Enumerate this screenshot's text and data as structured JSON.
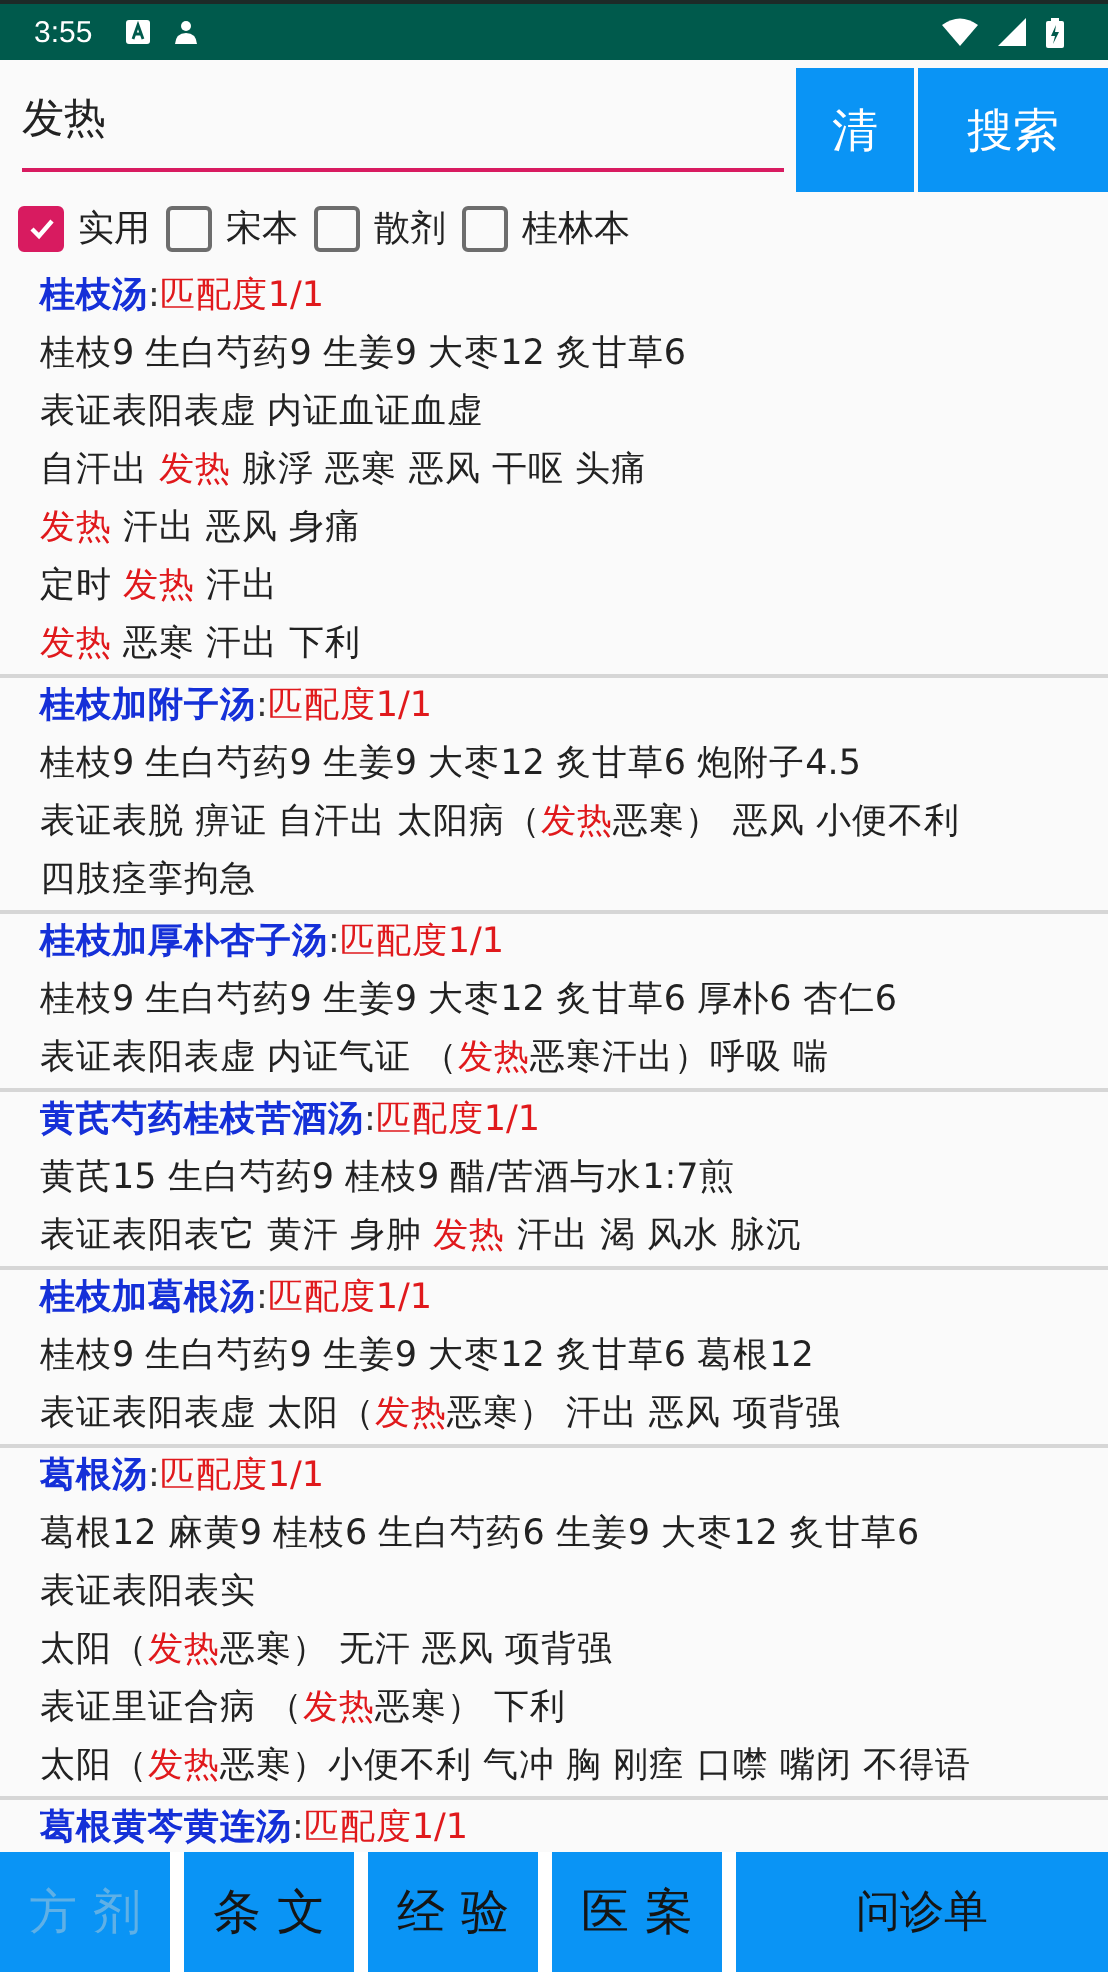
{
  "status_bar": {
    "time": "3:55"
  },
  "search": {
    "value": "发热",
    "buttons": [
      "清",
      "搜索"
    ]
  },
  "filters": [
    {
      "label": "实用",
      "checked": true
    },
    {
      "label": "宋本",
      "checked": false
    },
    {
      "label": "散剂",
      "checked": false
    },
    {
      "label": "桂林本",
      "checked": false
    }
  ],
  "results": [
    {
      "name": "桂枝汤",
      "separator": ":",
      "match": "匹配度1/1",
      "lines": [
        [
          {
            "text": "桂枝9 生白芍药9 生姜9 大枣12 炙甘草6",
            "hit": false
          }
        ],
        [
          {
            "text": "表证表阳表虚 内证血证血虚",
            "hit": false
          }
        ],
        [
          {
            "text": "自汗出 ",
            "hit": false
          },
          {
            "text": "发热",
            "hit": true
          },
          {
            "text": " 脉浮 恶寒 恶风 干呕 头痛",
            "hit": false
          }
        ],
        [
          {
            "text": "发热",
            "hit": true
          },
          {
            "text": " 汗出 恶风 身痛",
            "hit": false
          }
        ],
        [
          {
            "text": "定时 ",
            "hit": false
          },
          {
            "text": "发热",
            "hit": true
          },
          {
            "text": " 汗出",
            "hit": false
          }
        ],
        [
          {
            "text": "发热",
            "hit": true
          },
          {
            "text": " 恶寒 汗出 下利",
            "hit": false
          }
        ]
      ]
    },
    {
      "name": "桂枝加附子汤",
      "separator": ":",
      "match": "匹配度1/1",
      "lines": [
        [
          {
            "text": "桂枝9 生白芍药9 生姜9 大枣12 炙甘草6 炮附子4.5",
            "hit": false
          }
        ],
        [
          {
            "text": "表证表脱 痹证 自汗出 太阳病（",
            "hit": false
          },
          {
            "text": "发热",
            "hit": true
          },
          {
            "text": "恶寒） 恶风 小便不利",
            "hit": false
          }
        ],
        [
          {
            "text": "四肢痉挛拘急",
            "hit": false
          }
        ]
      ]
    },
    {
      "name": "桂枝加厚朴杏子汤",
      "separator": ":",
      "match": "匹配度1/1",
      "lines": [
        [
          {
            "text": "桂枝9 生白芍药9 生姜9 大枣12 炙甘草6 厚朴6 杏仁6",
            "hit": false
          }
        ],
        [
          {
            "text": "表证表阳表虚 内证气证 （",
            "hit": false
          },
          {
            "text": "发热",
            "hit": true
          },
          {
            "text": "恶寒汗出）呼吸 喘",
            "hit": false
          }
        ]
      ]
    },
    {
      "name": "黄芪芍药桂枝苦酒汤",
      "separator": ":",
      "match": "匹配度1/1",
      "lines": [
        [
          {
            "text": "黄芪15 生白芍药9 桂枝9 醋/苦酒与水1:7煎",
            "hit": false
          }
        ],
        [
          {
            "text": "表证表阳表它 黄汗 身肿 ",
            "hit": false
          },
          {
            "text": "发热",
            "hit": true
          },
          {
            "text": " 汗出 渴 风水 脉沉",
            "hit": false
          }
        ]
      ]
    },
    {
      "name": "桂枝加葛根汤",
      "separator": ":",
      "match": "匹配度1/1",
      "lines": [
        [
          {
            "text": "桂枝9 生白芍药9 生姜9 大枣12 炙甘草6 葛根12",
            "hit": false
          }
        ],
        [
          {
            "text": "表证表阳表虚 太阳（",
            "hit": false
          },
          {
            "text": "发热",
            "hit": true
          },
          {
            "text": "恶寒） 汗出 恶风 项背强",
            "hit": false
          }
        ]
      ]
    },
    {
      "name": "葛根汤",
      "separator": ":",
      "match": "匹配度1/1",
      "lines": [
        [
          {
            "text": "葛根12 麻黄9 桂枝6 生白芍药6 生姜9 大枣12 炙甘草6",
            "hit": false
          }
        ],
        [
          {
            "text": "表证表阳表实",
            "hit": false
          }
        ],
        [
          {
            "text": "太阳（",
            "hit": false
          },
          {
            "text": "发热",
            "hit": true
          },
          {
            "text": "恶寒） 无汗 恶风 项背强",
            "hit": false
          }
        ],
        [
          {
            "text": "表证里证合病 （",
            "hit": false
          },
          {
            "text": "发热",
            "hit": true
          },
          {
            "text": "恶寒） 下利",
            "hit": false
          }
        ],
        [
          {
            "text": "太阳（",
            "hit": false
          },
          {
            "text": "发热",
            "hit": true
          },
          {
            "text": "恶寒）小便不利 气冲 胸 刚痓 口噤 嘴闭 不得语",
            "hit": false
          }
        ]
      ]
    },
    {
      "name": "葛根黄芩黄连汤",
      "separator": ":",
      "match": "匹配度1/1"
    }
  ],
  "tabs": [
    {
      "label": "方剂",
      "selected": true
    },
    {
      "label": "条文",
      "selected": false
    },
    {
      "label": "经验",
      "selected": false
    },
    {
      "label": "医案",
      "selected": false
    },
    {
      "label": "问诊单",
      "selected": false
    }
  ]
}
